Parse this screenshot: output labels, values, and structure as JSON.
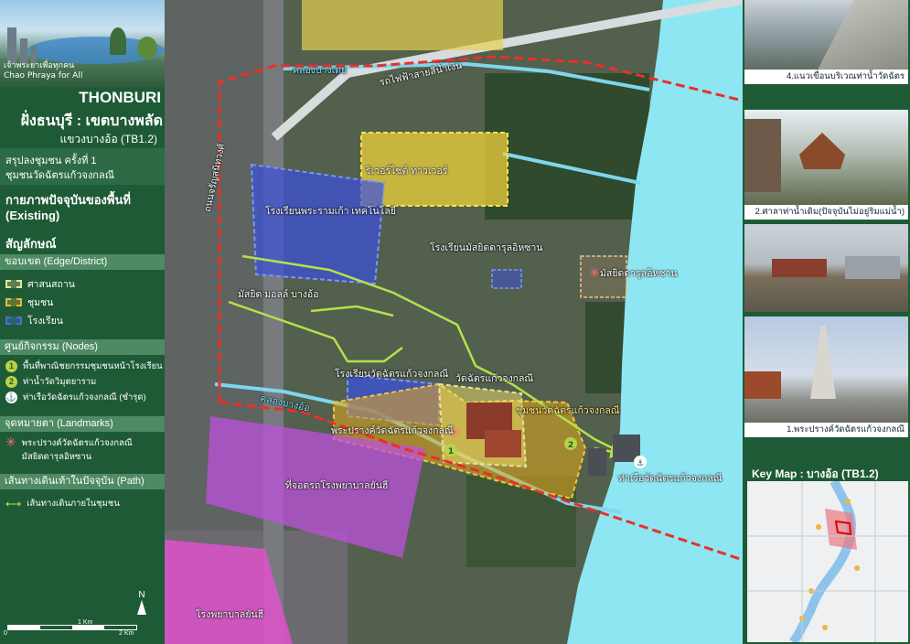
{
  "banner": {
    "tag_th": "เจ้าพระยาเพื่อทุกคน",
    "tag_en": "Chao Phraya for All"
  },
  "sidebar": {
    "title_en": "THONBURI",
    "title_th": "ฝั่งธนบุรี : เขตบางพลัด",
    "subtitle": "แขวงบางอ้อ (TB1.2)",
    "summary_line1": "สรุปลงชุมชน ครั้งที่ 1",
    "summary_line2": "ชุมชนวัดฉัตรแก้วจงกลณี",
    "existing_th": "กายภาพปัจจุบันของพื้นที่",
    "existing_en": "(Existing)",
    "symbols": "สัญลักษณ์",
    "edge_head": "ขอบเขต (Edge/District)",
    "edge_items": [
      {
        "label": "ศาสนสถาน",
        "color": "#e6e39a"
      },
      {
        "label": "ชุมชน",
        "color": "#e8b93a"
      },
      {
        "label": "โรงเรียน",
        "color": "#4a6de0"
      }
    ],
    "nodes_head": "ศูนย์กิจกรรม (Nodes)",
    "nodes": [
      {
        "num": "1",
        "label": "พื้นที่พาณิชยกรรมชุมชนหน้าโรงเรียน"
      },
      {
        "num": "2",
        "label": "ท่าน้ำวัดวิมุตยาราม"
      },
      {
        "num": "⚓",
        "label": "ท่าเรือวัดฉัตรแก้วจงกลณี (ชำรุด)"
      }
    ],
    "landmark_head": "จุดหมายตา (Landmarks)",
    "landmark_line1": "พระปรางค์วัดฉัตรแก้วจงกลณี",
    "landmark_line2": "มัสยิดดารุลอิหซาน",
    "path_head": "เส้นทางเดินเท้าในปัจจุบัน (Path)",
    "path_label": "เส้นทางเดินภายในชุมชน"
  },
  "map": {
    "labels": {
      "klong_bang_phlat": "คลองบางเดย",
      "bts": "รถไฟฟ้าสายสีน้ำเงิน",
      "road": "ถนนจรัญสนิทวงศ์",
      "riverside": "ริเวอร์ไซต์ ทาวเวอร์",
      "school_tech": "โรงเรียนพระรามเก้า เทคโนโลยี",
      "mosque_school": "โรงเรียนมัสยิดดารุลอิหซาน",
      "mosque": "มัสยิดดารุลอิหซาน",
      "mosque_mall": "มัสยิด มอลล์ บางอ้อ",
      "school_wat": "โรงเรียนวัดฉัตรแก้วจงกลณี",
      "wat": "วัดฉัตรแก้วจงกลณี",
      "community": "ชุมชนวัดฉัตรแก้วจงกลณี",
      "klong_bang_o": "คลองบางอ้อ",
      "prang": "พระปรางค์วัดฉัตรแก้วจงกลณี",
      "factory": "ที่จอดรถโรงพยาบาลยันฮี",
      "pier": "ท่าเรือวัดฉัตรแก้วจงกลณี",
      "hospital": "โรงพยาบาลยันฮี"
    },
    "scale": {
      "s0": "0",
      "s1": "1 Km",
      "s2": "2 Km"
    },
    "north": "N"
  },
  "photos": [
    {
      "caption": "4.แนวเขื่อนบริเวณท่าน้ำวัดฉัตร"
    },
    {
      "caption": "2.ศาลาท่าน้ำเดิม(ปัจจุบันไม่อยู่ริมแม่น้ำ)"
    },
    {
      "caption": ""
    },
    {
      "caption": "1.พระปรางค์วัดฉัตรแก้วจงกลณี"
    }
  ],
  "keymap": {
    "title": "Key Map : บางอ้อ (TB1.2)"
  },
  "colors": {
    "river": "#8ee6f2",
    "boundary": "#e8312a",
    "canal": "#7fd6ee",
    "path": "#b5e14a"
  }
}
